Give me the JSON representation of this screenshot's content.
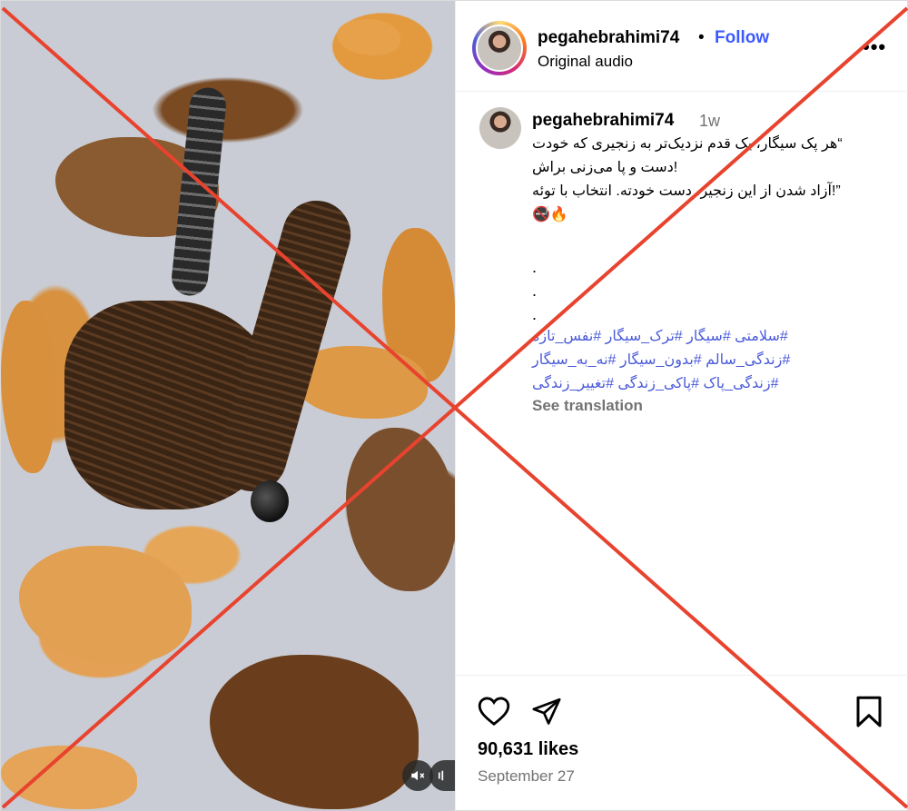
{
  "post": {
    "username": "pegahebrahimi74",
    "follow_label": "Follow",
    "separator": "•",
    "audio_label": "Original audio",
    "more_icon": "more-horizontal-icon"
  },
  "comment": {
    "username": "pegahebrahimi74",
    "time": "1w",
    "caption_lines": [
      "“هر پک سیگار، یک قدم نزدیک‌تر به زنجیری که خودت",
      "!دست و پا می‌زنی براش",
      "”!آزاد شدن از این زنجیر، دست خودته. انتخاب با توئه",
      "🚭🔥"
    ],
    "dots": [
      ".",
      ".",
      "."
    ],
    "hashtag_lines": [
      "#سلامتی #سیگار #ترک_سیگار #نفس_تازه",
      "#زندگی_سالم #بدون_سیگار #نه_به_سیگار",
      "#زندگی_پاک #پاکی_زندگی #تغییر_زندگی"
    ],
    "see_translation": "See translation"
  },
  "actions": {
    "likes": "90,631 likes",
    "date": "September 27",
    "icons": [
      "heart-icon",
      "share-icon",
      "bookmark-icon"
    ]
  },
  "media": {
    "controls": [
      "mute-icon",
      "audio-icon"
    ]
  },
  "overlay": {
    "color": "#e8432e"
  },
  "colors": {
    "link_blue": "#3d5afe",
    "hashtag_blue": "#4a5bd8",
    "muted_gray": "#737373"
  }
}
